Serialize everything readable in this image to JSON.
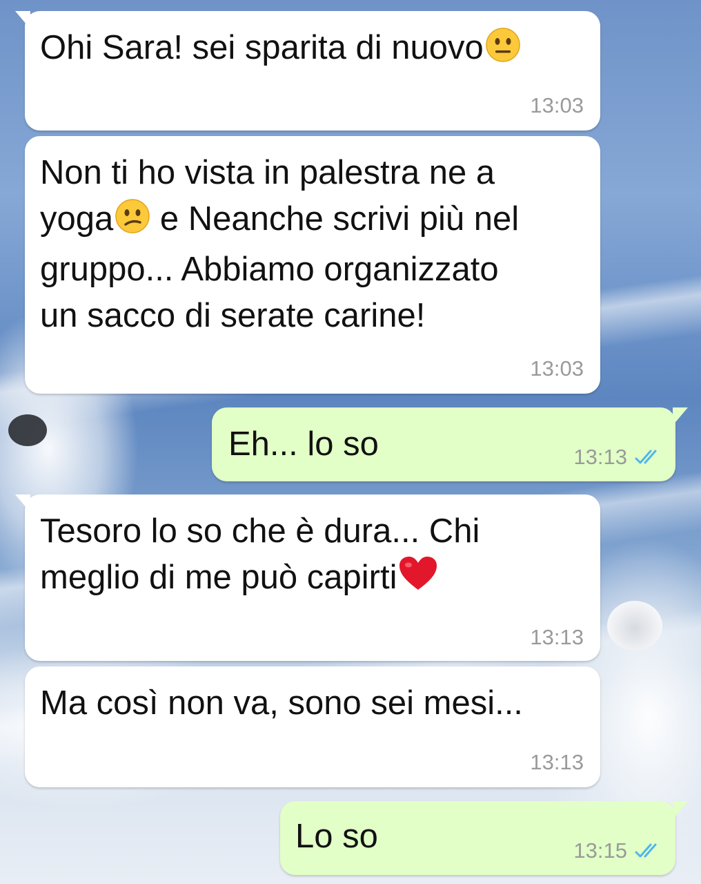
{
  "messages": [
    {
      "direction": "incoming",
      "text": "Ohi Sara! sei sparita di nuovo",
      "emoji": "neutral-face-icon",
      "time": "13:03"
    },
    {
      "direction": "incoming",
      "lines": [
        "Non ti ho vista in palestra ne a",
        "yoga",
        " e Neanche scrivi più nel",
        "gruppo... Abbiamo organizzato",
        "un sacco di serate carine!"
      ],
      "emoji": "confused-face-icon",
      "time": "13:03"
    },
    {
      "direction": "outgoing",
      "text": "Eh... lo so",
      "time": "13:13",
      "status": "read"
    },
    {
      "direction": "incoming",
      "lines": [
        "Tesoro lo so che è dura... Chi",
        "meglio di me può capirti"
      ],
      "emoji": "red-heart-icon",
      "time": "13:13"
    },
    {
      "direction": "incoming",
      "text": "Ma così non va, sono sei mesi...",
      "time": "13:13"
    },
    {
      "direction": "outgoing",
      "text": "Lo so",
      "time": "13:15",
      "status": "read"
    }
  ],
  "colors": {
    "incoming_bubble": "#ffffff",
    "outgoing_bubble": "#e2ffc7",
    "timestamp": "#9a9a9a",
    "read_ticks": "#4fb6ec"
  }
}
